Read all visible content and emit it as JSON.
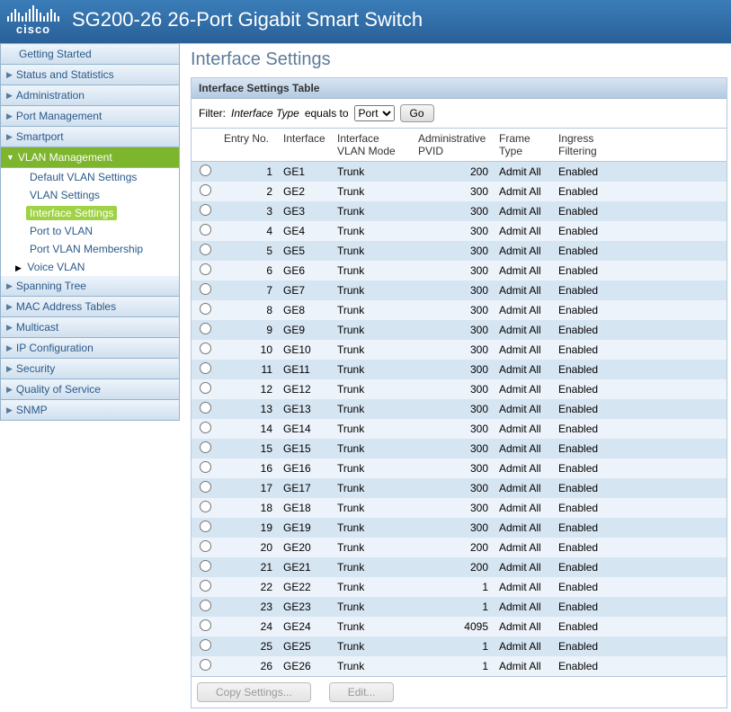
{
  "product_title": "SG200-26 26-Port Gigabit Smart Switch",
  "cisco_label": "cisco",
  "sidebar": {
    "items": [
      {
        "label": "Getting Started",
        "expandable": false
      },
      {
        "label": "Status and Statistics",
        "expandable": true
      },
      {
        "label": "Administration",
        "expandable": true
      },
      {
        "label": "Port Management",
        "expandable": true
      },
      {
        "label": "Smartport",
        "expandable": true
      },
      {
        "label": "VLAN Management",
        "expandable": true,
        "active": true,
        "children": [
          {
            "label": "Default VLAN Settings"
          },
          {
            "label": "VLAN Settings"
          },
          {
            "label": "Interface Settings",
            "selected": true
          },
          {
            "label": "Port to VLAN"
          },
          {
            "label": "Port VLAN Membership"
          },
          {
            "label": "Voice VLAN",
            "expandable": true
          }
        ]
      },
      {
        "label": "Spanning Tree",
        "expandable": true
      },
      {
        "label": "MAC Address Tables",
        "expandable": true
      },
      {
        "label": "Multicast",
        "expandable": true
      },
      {
        "label": "IP Configuration",
        "expandable": true
      },
      {
        "label": "Security",
        "expandable": true
      },
      {
        "label": "Quality of Service",
        "expandable": true
      },
      {
        "label": "SNMP",
        "expandable": true
      }
    ]
  },
  "page_title": "Interface Settings",
  "table_title": "Interface Settings Table",
  "filter": {
    "label_prefix": "Filter:",
    "label_mid": "Interface Type",
    "label_equals": "equals to",
    "selected": "Port",
    "go": "Go"
  },
  "columns": {
    "entry": "Entry No.",
    "interface": "Interface",
    "mode1": "Interface",
    "mode2": "VLAN Mode",
    "pvid1": "Administrative",
    "pvid2": "PVID",
    "frame1": "Frame",
    "frame2": "Type",
    "ingress1": "Ingress",
    "ingress2": "Filtering"
  },
  "rows": [
    {
      "n": 1,
      "if": "GE1",
      "mode": "Trunk",
      "pvid": 200,
      "ft": "Admit All",
      "ing": "Enabled"
    },
    {
      "n": 2,
      "if": "GE2",
      "mode": "Trunk",
      "pvid": 300,
      "ft": "Admit All",
      "ing": "Enabled"
    },
    {
      "n": 3,
      "if": "GE3",
      "mode": "Trunk",
      "pvid": 300,
      "ft": "Admit All",
      "ing": "Enabled"
    },
    {
      "n": 4,
      "if": "GE4",
      "mode": "Trunk",
      "pvid": 300,
      "ft": "Admit All",
      "ing": "Enabled"
    },
    {
      "n": 5,
      "if": "GE5",
      "mode": "Trunk",
      "pvid": 300,
      "ft": "Admit All",
      "ing": "Enabled"
    },
    {
      "n": 6,
      "if": "GE6",
      "mode": "Trunk",
      "pvid": 300,
      "ft": "Admit All",
      "ing": "Enabled"
    },
    {
      "n": 7,
      "if": "GE7",
      "mode": "Trunk",
      "pvid": 300,
      "ft": "Admit All",
      "ing": "Enabled"
    },
    {
      "n": 8,
      "if": "GE8",
      "mode": "Trunk",
      "pvid": 300,
      "ft": "Admit All",
      "ing": "Enabled"
    },
    {
      "n": 9,
      "if": "GE9",
      "mode": "Trunk",
      "pvid": 300,
      "ft": "Admit All",
      "ing": "Enabled"
    },
    {
      "n": 10,
      "if": "GE10",
      "mode": "Trunk",
      "pvid": 300,
      "ft": "Admit All",
      "ing": "Enabled"
    },
    {
      "n": 11,
      "if": "GE11",
      "mode": "Trunk",
      "pvid": 300,
      "ft": "Admit All",
      "ing": "Enabled"
    },
    {
      "n": 12,
      "if": "GE12",
      "mode": "Trunk",
      "pvid": 300,
      "ft": "Admit All",
      "ing": "Enabled"
    },
    {
      "n": 13,
      "if": "GE13",
      "mode": "Trunk",
      "pvid": 300,
      "ft": "Admit All",
      "ing": "Enabled"
    },
    {
      "n": 14,
      "if": "GE14",
      "mode": "Trunk",
      "pvid": 300,
      "ft": "Admit All",
      "ing": "Enabled"
    },
    {
      "n": 15,
      "if": "GE15",
      "mode": "Trunk",
      "pvid": 300,
      "ft": "Admit All",
      "ing": "Enabled"
    },
    {
      "n": 16,
      "if": "GE16",
      "mode": "Trunk",
      "pvid": 300,
      "ft": "Admit All",
      "ing": "Enabled"
    },
    {
      "n": 17,
      "if": "GE17",
      "mode": "Trunk",
      "pvid": 300,
      "ft": "Admit All",
      "ing": "Enabled"
    },
    {
      "n": 18,
      "if": "GE18",
      "mode": "Trunk",
      "pvid": 300,
      "ft": "Admit All",
      "ing": "Enabled"
    },
    {
      "n": 19,
      "if": "GE19",
      "mode": "Trunk",
      "pvid": 300,
      "ft": "Admit All",
      "ing": "Enabled"
    },
    {
      "n": 20,
      "if": "GE20",
      "mode": "Trunk",
      "pvid": 200,
      "ft": "Admit All",
      "ing": "Enabled"
    },
    {
      "n": 21,
      "if": "GE21",
      "mode": "Trunk",
      "pvid": 200,
      "ft": "Admit All",
      "ing": "Enabled"
    },
    {
      "n": 22,
      "if": "GE22",
      "mode": "Trunk",
      "pvid": 1,
      "ft": "Admit All",
      "ing": "Enabled"
    },
    {
      "n": 23,
      "if": "GE23",
      "mode": "Trunk",
      "pvid": 1,
      "ft": "Admit All",
      "ing": "Enabled"
    },
    {
      "n": 24,
      "if": "GE24",
      "mode": "Trunk",
      "pvid": 4095,
      "ft": "Admit All",
      "ing": "Enabled"
    },
    {
      "n": 25,
      "if": "GE25",
      "mode": "Trunk",
      "pvid": 1,
      "ft": "Admit All",
      "ing": "Enabled"
    },
    {
      "n": 26,
      "if": "GE26",
      "mode": "Trunk",
      "pvid": 1,
      "ft": "Admit All",
      "ing": "Enabled"
    }
  ],
  "buttons": {
    "copy": "Copy Settings...",
    "edit": "Edit..."
  }
}
